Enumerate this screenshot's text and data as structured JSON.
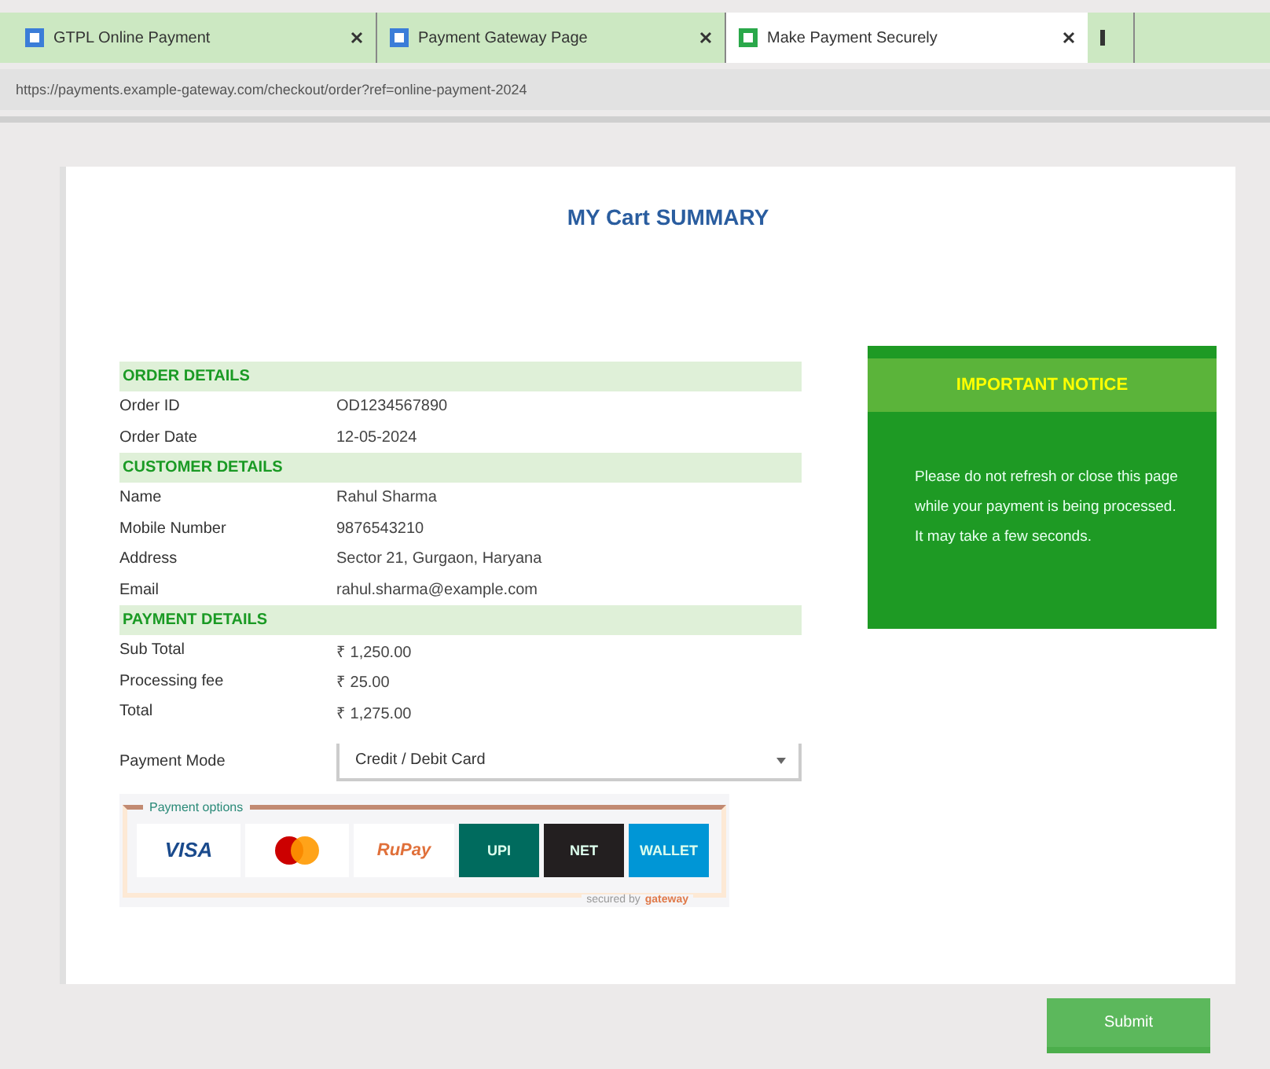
{
  "browser": {
    "tabs": [
      {
        "title": "GTPL Online Payment",
        "selected": false
      },
      {
        "title": "Payment Gateway Page",
        "selected": false
      },
      {
        "title": "Make Payment Securely",
        "selected": true
      }
    ],
    "address": "https://payments.example-gateway.com/checkout/order?ref=online-payment-2024"
  },
  "page": {
    "title": "MY Cart SUMMARY",
    "sections": [
      {
        "heading": "ORDER DETAILS",
        "rows": [
          {
            "label": "Order ID",
            "value": "OD1234567890"
          },
          {
            "label": "Order Date",
            "value": "12-05-2024"
          }
        ]
      },
      {
        "heading": "CUSTOMER DETAILS",
        "rows": [
          {
            "label": "Name",
            "value": "Rahul Sharma"
          },
          {
            "label": "Mobile Number",
            "value": "9876543210"
          },
          {
            "label": "Address",
            "value": "Sector 21, Gurgaon, Haryana"
          },
          {
            "label": "Email",
            "value": "rahul.sharma@example.com"
          }
        ]
      },
      {
        "heading": "PAYMENT DETAILS",
        "rows": [
          {
            "label": "Sub Total",
            "value": "₹ 1,250.00"
          },
          {
            "label": "Processing fee",
            "value": "₹ 25.00"
          },
          {
            "label": "Total",
            "value": "₹ 1,275.00"
          }
        ]
      }
    ],
    "payment_mode": {
      "label": "Payment Mode",
      "value": "Credit / Debit Card"
    },
    "payment_options": {
      "legend": "Payment options",
      "logos": [
        {
          "kind": "visa",
          "text": "VISA"
        },
        {
          "kind": "mastercard"
        },
        {
          "kind": "rupay",
          "text": "RuPay"
        },
        {
          "kind": "tile",
          "text": "UPI",
          "color": "#006b5e"
        },
        {
          "kind": "tile",
          "text": "NET",
          "color": "#231f20"
        },
        {
          "kind": "tile",
          "text": "WALLET",
          "color": "#0096d6"
        }
      ],
      "secured": "secured by",
      "brand": "gateway"
    },
    "notice": {
      "title": "IMPORTANT NOTICE",
      "text": "Please do not refresh or close this page while your payment is being processed. It may take a few seconds."
    },
    "submit": "Submit"
  }
}
